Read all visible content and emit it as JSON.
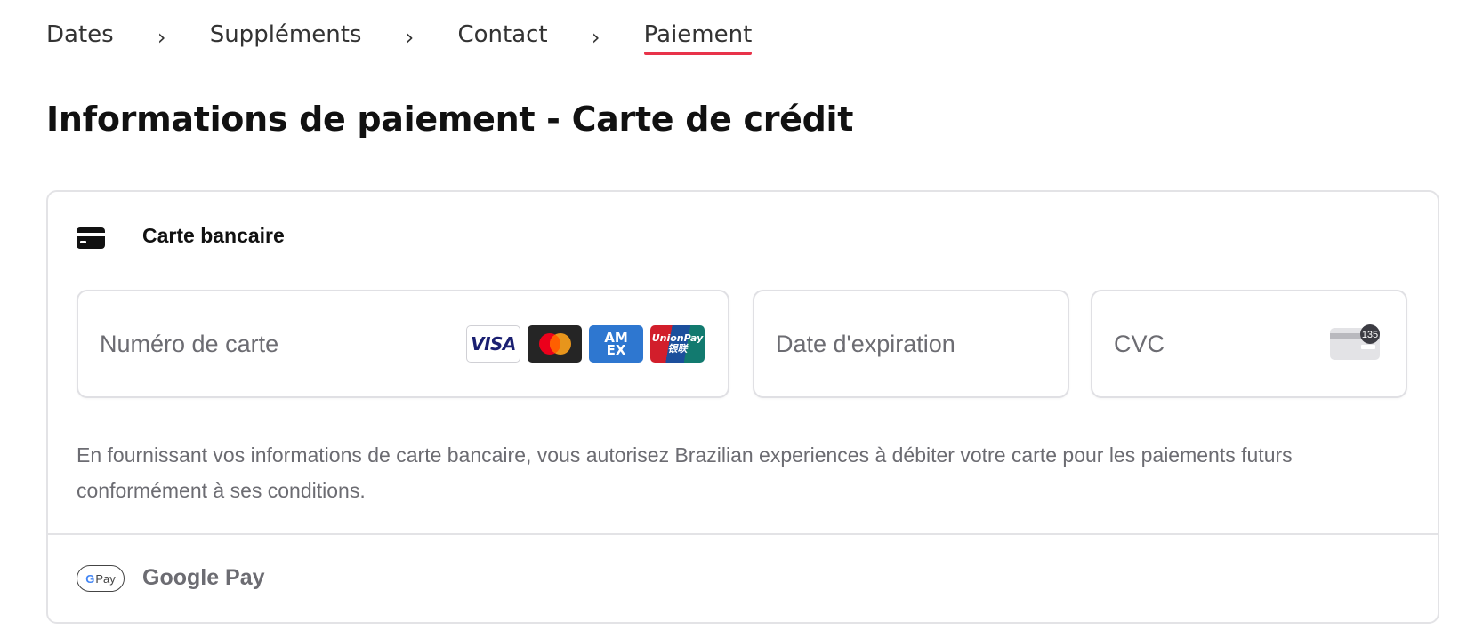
{
  "breadcrumb": {
    "steps": [
      {
        "label": "Dates"
      },
      {
        "label": "Suppléments"
      },
      {
        "label": "Contact"
      },
      {
        "label": "Paiement"
      }
    ],
    "separator": "›",
    "active_index": 3,
    "active_color": "#e8334a"
  },
  "page": {
    "title": "Informations de paiement - Carte de crédit"
  },
  "card_method": {
    "icon": "credit-card-icon",
    "title": "Carte bancaire",
    "card_number": {
      "placeholder": "Numéro de carte",
      "brands": [
        {
          "name": "visa-icon",
          "text": "VISA",
          "color": "#1a1f71"
        },
        {
          "name": "mastercard-icon",
          "color": "#252525"
        },
        {
          "name": "amex-icon",
          "text": "AM EX",
          "color": "#2e77d0"
        },
        {
          "name": "unionpay-icon",
          "text": "UnionPay 银联"
        }
      ]
    },
    "expiry": {
      "placeholder": "Date d'expiration"
    },
    "cvc": {
      "placeholder": "CVC",
      "icon": "cvc-card-icon",
      "icon_text": "135"
    },
    "notice": "En fournissant vos informations de carte bancaire, vous autorisez Brazilian experiences à débiter votre carte pour les paiements futurs conformément à ses conditions."
  },
  "gpay_method": {
    "badge_g": "G",
    "badge_text": "Pay",
    "label": "Google Pay"
  }
}
